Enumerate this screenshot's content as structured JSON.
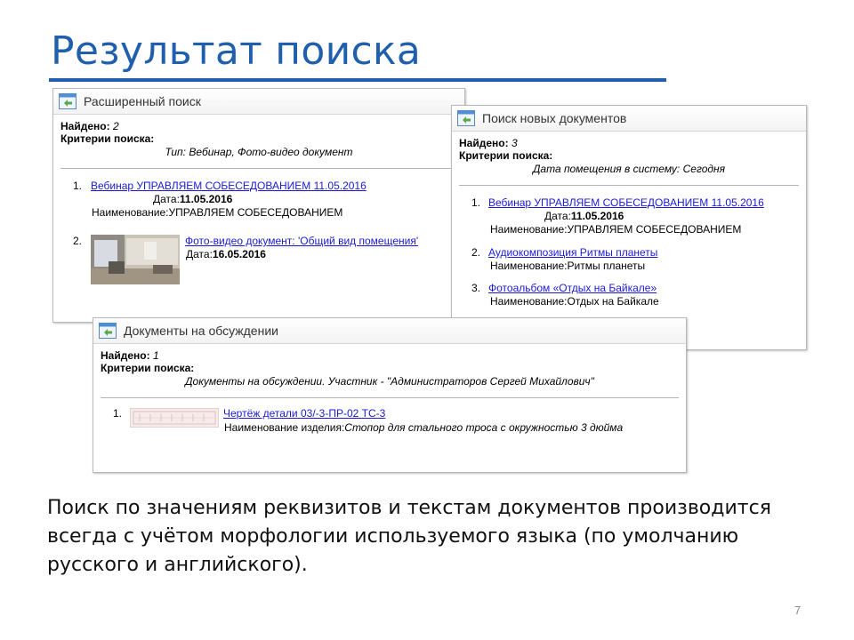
{
  "slide": {
    "title": "Результат поиска",
    "description": "Поиск по значениям реквизитов и текстам документов производится всегда с учётом морфологии используемого языка (по умолчанию русского и английского).",
    "page_number": "7"
  },
  "labels": {
    "found": "Найдено:",
    "criteria": "Критерии поиска:"
  },
  "panel_advanced": {
    "title": "Расширенный поиск",
    "found_count": "2",
    "criteria": "Тип: Вебинар, Фото-видео документ",
    "results": [
      {
        "num": "1.",
        "link": "Вебинар УПРАВЛЯЕМ СОБЕСЕДОВАНИЕМ 11.05.2016",
        "date_label": "Дата:",
        "date": "11.05.2016",
        "name_label": "Наименование:",
        "name": "УПРАВЛЯЕМ СОБЕСЕДОВАНИЕМ"
      },
      {
        "num": "2.",
        "link": "Фото-видео документ: 'Общий вид помещения'",
        "date_label": "Дата:",
        "date": "16.05.2016"
      }
    ]
  },
  "panel_new": {
    "title": "Поиск новых документов",
    "found_count": "3",
    "criteria": "Дата помещения в систему: Сегодня",
    "results": [
      {
        "num": "1.",
        "link": "Вебинар УПРАВЛЯЕМ СОБЕСЕДОВАНИЕМ 11.05.2016",
        "date_label": "Дата:",
        "date": "11.05.2016",
        "name_label": "Наименование:",
        "name": "УПРАВЛЯЕМ СОБЕСЕДОВАНИЕМ"
      },
      {
        "num": "2.",
        "link": "Аудиокомпозиция Ритмы планеты",
        "name_label": "Наименование:",
        "name": "Ритмы планеты"
      },
      {
        "num": "3.",
        "link": "Фотоальбом «Отдых на Байкале»",
        "name_label": "Наименование:",
        "name": "Отдых на Байкале"
      }
    ]
  },
  "panel_discussion": {
    "title": "Документы на обсуждении",
    "found_count": "1",
    "criteria": "Документы на обсуждении. Участник - \"Администраторов Сергей Михайлович\"",
    "results": [
      {
        "num": "1.",
        "link": "Чертёж детали 03/-3-ПР-02 ТС-3",
        "name_label": "Наименование изделия:",
        "name": "Стопор для стального троса с окружностью 3 дюйма"
      }
    ]
  },
  "icons": {
    "panel_icon": "search-window-icon"
  },
  "colors": {
    "title": "#1f5fae",
    "link": "#1a1ad8"
  }
}
